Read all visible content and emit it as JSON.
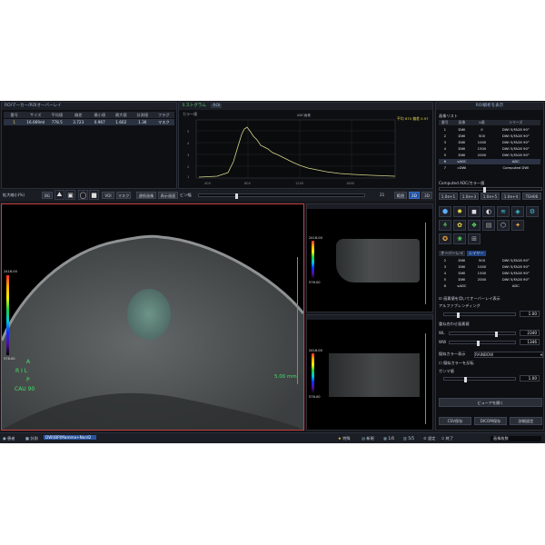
{
  "roi_panel": {
    "title": "ROIマーカー/ROIオーバーレイ",
    "columns": [
      "番号",
      "サイズ",
      "平均値",
      "偏差",
      "最小値",
      "最大値",
      "計測値",
      "フラグ"
    ],
    "rows": [
      {
        "cells": [
          "1",
          "16.669ml",
          "778.5",
          "3.723",
          "0.967",
          "1.602",
          "1.36",
          "マスク"
        ]
      }
    ]
  },
  "histogram": {
    "title": "ヒストグラム",
    "tab": "ROI",
    "subtitle": "カラー値",
    "legend": "ADC画像",
    "stats_label": "平均",
    "stats_value": "870",
    "stats2_label": "偏差",
    "stats2_value": "0.97",
    "x_ticks": [
      "400",
      "800",
      "1200",
      "1600"
    ],
    "y_ticks": [
      "5",
      "4",
      "3",
      "2",
      "1"
    ],
    "line_color": "#d6d68a"
  },
  "toolbar": {
    "scale_label": "拡大縮小(%)",
    "items": [
      "BG",
      "VOI",
      "マスク",
      "連続画像",
      "表示画面",
      "ビン幅"
    ],
    "right_value": "21",
    "right_btns": [
      "範囲",
      "2D",
      "3D"
    ]
  },
  "main_view": {
    "orient_a": "A",
    "orient_rl": "R I L",
    "orient_p": "P",
    "orient_cau": "CAU 90",
    "scale_text": "5.00 mm",
    "cbar_top": "2416.00",
    "cbar_bottom": "576.00"
  },
  "top_view": {
    "cbar_top": "2416.00",
    "cbar_bottom": "576.00"
  },
  "bottom_view": {
    "cbar_top": "2416.00",
    "cbar_bottom": "576.00"
  },
  "right_panel": {
    "title": "ROI解析を表示",
    "series_label": "画像リスト",
    "series_columns": [
      "番号",
      "画像",
      "b値",
      "シリーズ"
    ],
    "series_rows": [
      [
        "1",
        "DWI",
        "0",
        "DWI 5/FA28 90°"
      ],
      [
        "2",
        "DWI",
        "500",
        "DWI 5/FA28 90°"
      ],
      [
        "3",
        "DWI",
        "1000",
        "DWI 5/FA28 90°"
      ],
      [
        "4",
        "DWI",
        "1500",
        "DWI 5/FA28 90°"
      ],
      [
        "5",
        "DWI",
        "2000",
        "DWI 5/FA28 90°"
      ],
      [
        "6",
        "sADC",
        "",
        "ADC"
      ],
      [
        "7",
        "cDWI",
        "",
        "Computed DWI"
      ]
    ],
    "computed_label": "Computed ADC/カラー値",
    "b_buttons": [
      "1.0e+1",
      "1.0e+3",
      "1.0e+5",
      "1.0e+4",
      "TEH06"
    ],
    "overlay_label": "オーバーレイ",
    "layer_label": "レイヤー",
    "layer_rows": [
      [
        "2",
        "DWI",
        "500",
        "DWI 5/FA28 90°"
      ],
      [
        "3",
        "DWI",
        "1000",
        "DWI 5/FA28 90°"
      ],
      [
        "4",
        "DWI",
        "1500",
        "DWI 5/FA28 90°"
      ],
      [
        "5",
        "DWI",
        "2000",
        "DWI 5/FA28 90°"
      ],
      [
        "6",
        "sADC",
        "",
        "ADC"
      ]
    ],
    "check1": "画素値を用いてオーバーレイ表示",
    "alpha_label": "アルファブレンディング",
    "alpha_value": "1.00",
    "window_label": "重ね合わせ画素値",
    "wl_value": "2340",
    "ww_value": "1346",
    "wl_label": "WL",
    "ww_label": "WW",
    "color_label": "擬似カラー表示",
    "color_value": "RAINBOW",
    "check2": "擬似カラーを反転",
    "gamma_label": "ガンマ値",
    "gamma_value": "1.00",
    "viewer_btn": "ビューアを開く",
    "csv_btn": "CSV保存",
    "dicom_btn": "DICOM保存",
    "detail_btn": "詳細設定"
  },
  "statusbar": {
    "left": [
      "患者",
      "計測"
    ],
    "filename": "DWI(BP)Mammo+Nord2",
    "right": [
      "特殊",
      "新規",
      "1/6",
      "5/5",
      "設定",
      "終了"
    ],
    "info": "画像枚数"
  }
}
